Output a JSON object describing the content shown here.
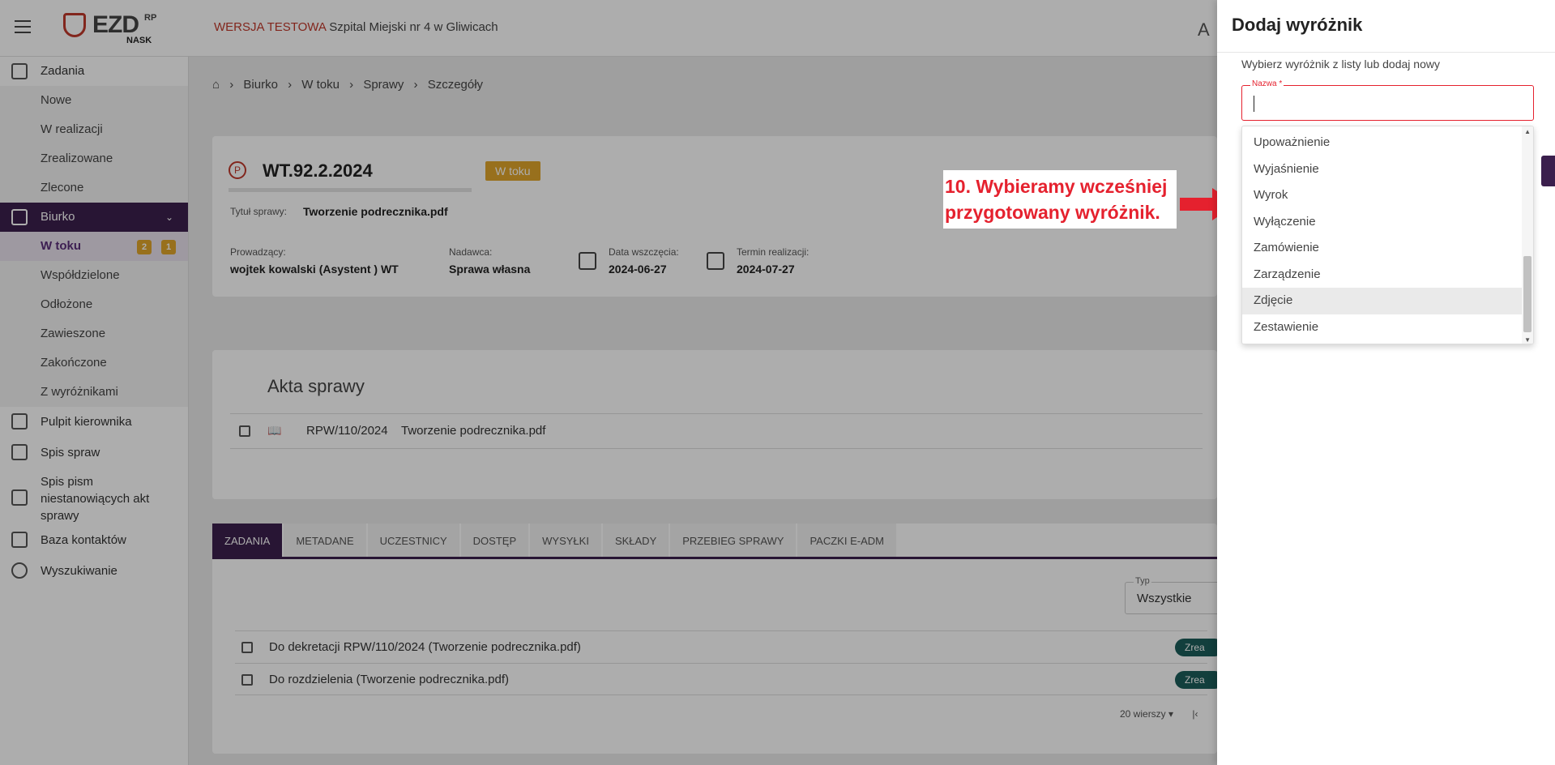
{
  "header": {
    "logo_text": "EZD",
    "logo_rp": "RP",
    "logo_nask": "NASK",
    "env_label": "WERSJA TESTOWA",
    "org_name": "Szpital Miejski nr 4 w Gliwicach",
    "font_toggle": "A"
  },
  "sidebar": {
    "zadania": "Zadania",
    "zadania_sub": [
      "Nowe",
      "W realizacji",
      "Zrealizowane",
      "Zlecone"
    ],
    "biurko": "Biurko",
    "biurko_sub": {
      "w_toku": "W toku",
      "w_toku_badge1": "2",
      "w_toku_badge2": "1",
      "wspoldzielone": "Współdzielone",
      "odlozone": "Odłożone",
      "zawieszone": "Zawieszone",
      "zakonczone": "Zakończone",
      "z_wyroznikami": "Z wyróżnikami"
    },
    "pulpit": "Pulpit kierownika",
    "spis_spraw": "Spis spraw",
    "spis_pism_1": "Spis pism",
    "spis_pism_2": "niestanowiących akt",
    "spis_pism_3": "sprawy",
    "baza": "Baza kontaktów",
    "wyszukiwanie": "Wyszukiwanie"
  },
  "breadcrumb": [
    "Biurko",
    "W toku",
    "Sprawy",
    "Szczegóły"
  ],
  "case": {
    "id": "WT.92.2.2024",
    "status": "W toku",
    "title_label": "Tytuł sprawy:",
    "title_value": "Tworzenie podrecznika.pdf",
    "owner_label": "Prowadzący:",
    "owner_value": "wojtek kowalski (Asystent ) WT",
    "sender_label": "Nadawca:",
    "sender_value": "Sprawa własna",
    "start_label": "Data wszczęcia:",
    "start_value": "2024-06-27",
    "due_label": "Termin realizacji:",
    "due_value": "2024-07-27"
  },
  "acts": {
    "title": "Akta sprawy",
    "row_number": "RPW/110/2024",
    "row_title": "Tworzenie podrecznika.pdf"
  },
  "tabs": [
    "ZADANIA",
    "METADANE",
    "UCZESTNICY",
    "DOSTĘP",
    "WYSYŁKI",
    "SKŁADY",
    "PRZEBIEG SPRAWY",
    "PACZKI E-ADM"
  ],
  "tasks": {
    "type_label": "Typ",
    "type_value": "Wszystkie",
    "rows": [
      {
        "text": "Do dekretacji RPW/110/2024 (Tworzenie podrecznika.pdf)",
        "status": "Zrea"
      },
      {
        "text": "Do rozdzielenia (Tworzenie podrecznika.pdf)",
        "status": "Zrea"
      }
    ],
    "rows_per_page": "20 wierszy"
  },
  "annotation": {
    "line1": "10. Wybieramy wcześniej",
    "line2": "przygotowany wyróżnik.",
    "color": "#e5212e"
  },
  "drawer": {
    "title": "Dodaj wyróżnik",
    "hint": "Wybierz wyróżnik z listy lub dodaj nowy",
    "name_label": "Nazwa *",
    "name_value": "",
    "options": [
      "Upoważnienie",
      "Wyjaśnienie",
      "Wyrok",
      "Wyłączenie",
      "Zamówienie",
      "Zarządzenie",
      "Zdjęcie",
      "Zestawienie"
    ],
    "highlighted": "Zdjęcie"
  },
  "colors": {
    "primary": "#3b1f4d",
    "warning": "#e0a52c",
    "success": "#1b5e5a",
    "danger": "#e5212e"
  }
}
